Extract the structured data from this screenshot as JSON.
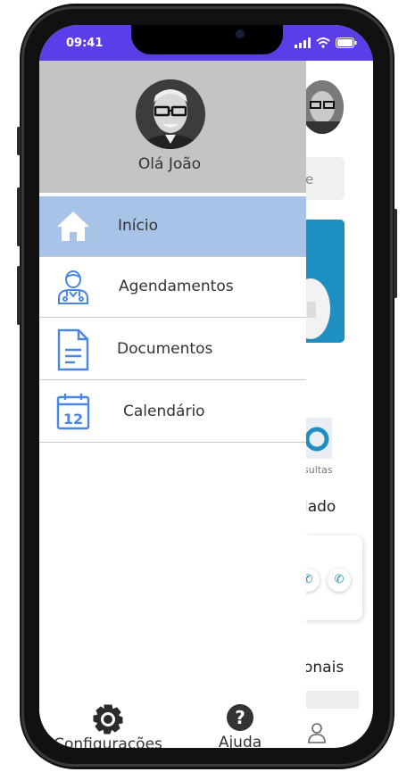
{
  "status_bar": {
    "time": "09:41"
  },
  "drawer": {
    "greeting": "Olá João",
    "menu": [
      {
        "label": "Início",
        "icon": "home-icon",
        "active": true
      },
      {
        "label": "Agendamentos",
        "icon": "doctor-icon",
        "active": false
      },
      {
        "label": "Documentos",
        "icon": "document-icon",
        "active": false
      },
      {
        "label": "Calendário",
        "icon": "calendar-icon",
        "active": false
      }
    ],
    "calendar_day": "12",
    "footer": [
      {
        "label": "Configurações",
        "icon": "gear-icon"
      },
      {
        "label": "Ajuda",
        "icon": "help-icon"
      }
    ]
  },
  "background": {
    "search_fragment": "e",
    "card_caption_fragment": "sultas",
    "section1_fragment": "lado",
    "section2_fragment": "onais"
  },
  "colors": {
    "status_bar": "#5b3ee8",
    "drawer_header": "#c4c4c4",
    "active_item": "#a8c3e8",
    "icon_blue": "#4a86e8"
  }
}
